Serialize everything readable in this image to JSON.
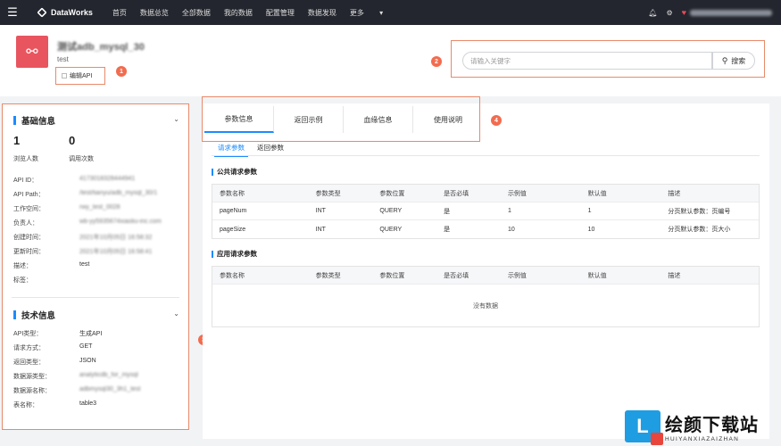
{
  "topbar": {
    "app_name": "DataWorks",
    "nav": [
      "首页",
      "数据总览",
      "全部数据",
      "我的数据",
      "配置管理",
      "数据发现",
      "更多"
    ],
    "user": "wb-yy5935674xiaoliu-inc.com"
  },
  "api": {
    "title": "测试adb_mysql_30",
    "desc": "test",
    "edit_label": "编辑API"
  },
  "search": {
    "placeholder": "请输入关键字",
    "button_label": "搜索"
  },
  "badges": [
    "1",
    "2",
    "3",
    "4"
  ],
  "basic_info": {
    "title": "基础信息",
    "views_count": "1",
    "views_label": "浏览人数",
    "calls_count": "0",
    "calls_label": "调用次数",
    "fields": [
      {
        "key": "API ID：",
        "value": "4173018328444941",
        "blurred": true
      },
      {
        "key": "API Path：",
        "value": "/test/tianyu/adb_mysql_30/1",
        "blurred": true
      },
      {
        "key": "工作空间：",
        "value": "rwy_test_0028",
        "blurred": true
      },
      {
        "key": "负责人：",
        "value": "wb-yy5935674xiaoliu-inc.com",
        "blurred": true
      },
      {
        "key": "创建时间：",
        "value": "2021年10月05日 16:58:32",
        "blurred": true
      },
      {
        "key": "更新时间：",
        "value": "2021年10月05日 16:58:41",
        "blurred": true
      },
      {
        "key": "描述：",
        "value": "test",
        "blurred": false
      },
      {
        "key": "标签：",
        "value": "",
        "blurred": false
      }
    ]
  },
  "tech_info": {
    "title": "技术信息",
    "fields": [
      {
        "key": "API类型：",
        "value": "生成API",
        "blurred": false
      },
      {
        "key": "请求方式：",
        "value": "GET",
        "blurred": false
      },
      {
        "key": "返回类型：",
        "value": "JSON",
        "blurred": false
      },
      {
        "key": "数据源类型：",
        "value": "analyticdb_for_mysql",
        "blurred": true
      },
      {
        "key": "数据源名称：",
        "value": "adbmysql30_3h1_test",
        "blurred": true
      },
      {
        "key": "表名称：",
        "value": "table3",
        "blurred": false
      }
    ]
  },
  "tabs": [
    "参数信息",
    "返回示例",
    "血缘信息",
    "使用说明"
  ],
  "subtabs": [
    "请求参数",
    "返回参数"
  ],
  "public_params": {
    "title": "公共请求参数",
    "headers": [
      "参数名称",
      "参数类型",
      "参数位置",
      "是否必填",
      "示例值",
      "默认值",
      "描述"
    ],
    "rows": [
      [
        "pageNum",
        "INT",
        "QUERY",
        "是",
        "1",
        "1",
        "分页默认参数：页编号"
      ],
      [
        "pageSize",
        "INT",
        "QUERY",
        "是",
        "10",
        "10",
        "分页默认参数：页大小"
      ]
    ]
  },
  "app_params": {
    "title": "应用请求参数",
    "headers": [
      "参数名称",
      "参数类型",
      "参数位置",
      "是否必填",
      "示例值",
      "默认值",
      "描述"
    ],
    "empty_text": "没有数据"
  },
  "watermark": {
    "main": "绘颜下载站",
    "sub": "HUIYANXIAZAIZHAN"
  }
}
